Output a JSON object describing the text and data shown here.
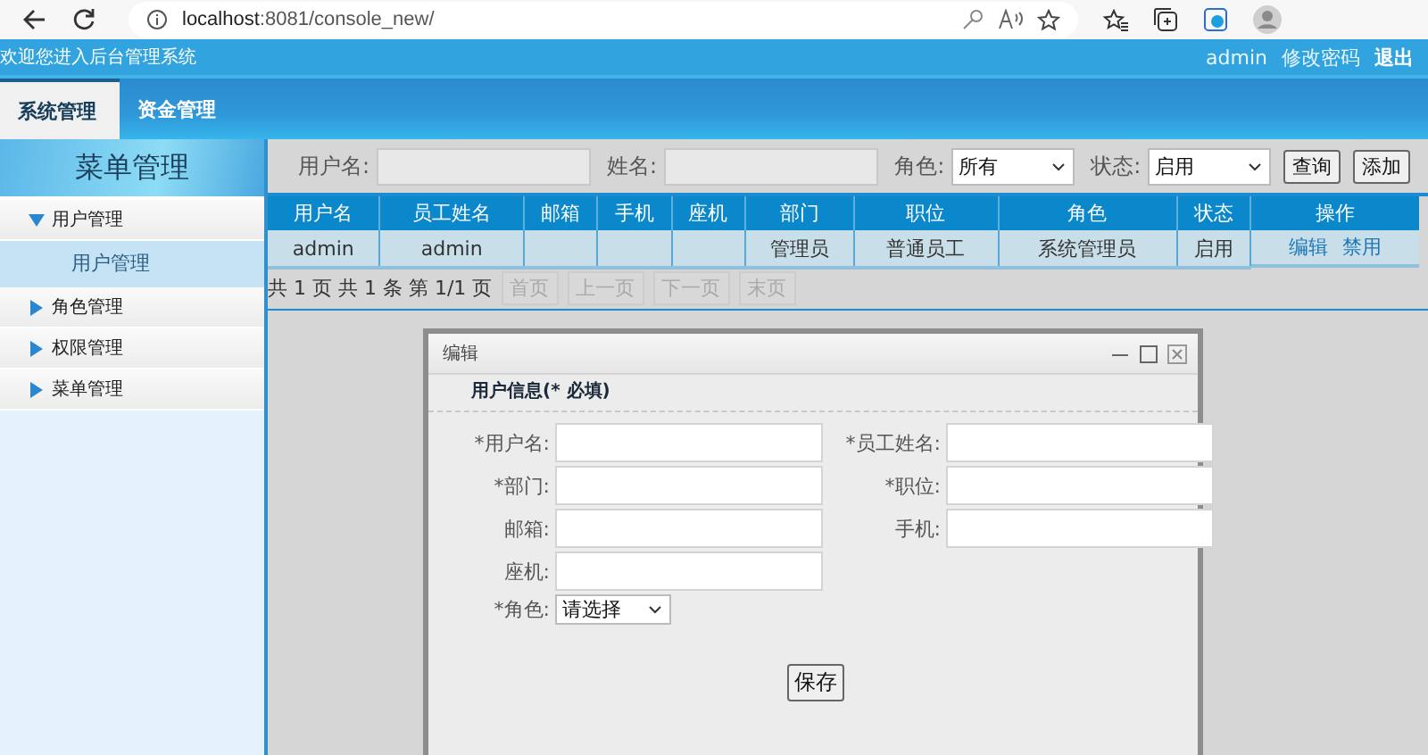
{
  "browser": {
    "address": "**localhost**:8081/console_new/"
  },
  "header": {
    "welcome": "欢迎您进入后台管理系统",
    "user": "admin",
    "links": [
      "修改密码",
      "退出"
    ]
  },
  "tabs": [
    {
      "label": "系统管理",
      "selected": true
    },
    {
      "label": "资金管理",
      "selected": false
    }
  ],
  "sidebar": {
    "title": "菜单管理",
    "items": [
      {
        "label": "用户管理",
        "expanded": true,
        "children": [
          {
            "label": "用户管理",
            "selected": true
          }
        ]
      },
      {
        "label": "角色管理",
        "expanded": false
      },
      {
        "label": "权限管理",
        "expanded": false
      },
      {
        "label": "菜单管理",
        "expanded": false
      }
    ]
  },
  "search": {
    "fields": [
      {
        "kind": "text",
        "label": "用户名:"
      },
      {
        "kind": "text",
        "label": "姓名:"
      },
      {
        "kind": "select",
        "label": "角色:",
        "value": "所有"
      },
      {
        "kind": "select",
        "label": "状态:",
        "value": "启用"
      }
    ],
    "buttons": [
      "查询",
      "添加"
    ]
  },
  "table": {
    "columns": [
      "用户名",
      "员工姓名",
      "邮箱",
      "手机",
      "座机",
      "部门",
      "职位",
      "角色",
      "状态",
      "操作"
    ],
    "rows": [
      {
        "cells": [
          "admin",
          "admin",
          "",
          "",
          "",
          "管理员",
          "普通员工",
          "系统管理员",
          "启用"
        ],
        "actions": [
          "编辑",
          "禁用"
        ]
      }
    ]
  },
  "pagination": {
    "info": "共 1 页 共 1 条 第 1/1 页",
    "buttons": [
      {
        "label": "首页",
        "disabled": true
      },
      {
        "label": "上一页",
        "disabled": true
      },
      {
        "label": "下一页",
        "disabled": true
      },
      {
        "label": "末页",
        "disabled": true
      }
    ]
  },
  "dialog": {
    "title": "编辑",
    "section": "用户信息(* 必填)",
    "fields": [
      {
        "kind": "text",
        "label": "*用户名:"
      },
      {
        "kind": "text",
        "label": "*员工姓名:"
      },
      {
        "kind": "text",
        "label": "*部门:"
      },
      {
        "kind": "text",
        "label": "*职位:"
      },
      {
        "kind": "text",
        "label": "邮箱:"
      },
      {
        "kind": "text",
        "label": "手机:"
      },
      {
        "kind": "text",
        "label": "座机:"
      },
      {
        "kind": "break"
      },
      {
        "kind": "select",
        "label": "*角色:",
        "value": "请选择"
      }
    ],
    "save": "保存"
  }
}
